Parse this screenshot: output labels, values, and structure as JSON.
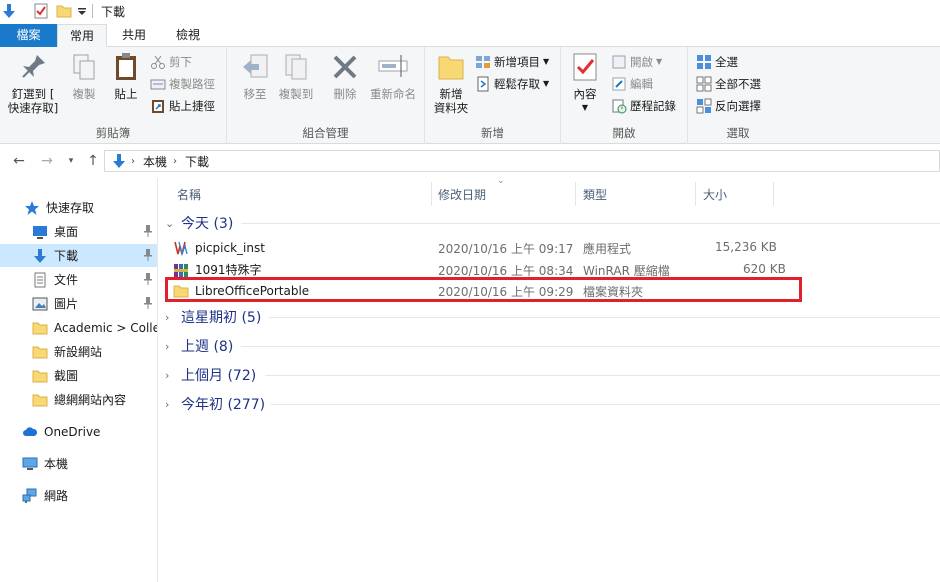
{
  "window": {
    "title": "下載"
  },
  "ribbon_tabs": [
    {
      "label": "檔案"
    },
    {
      "label": "常用"
    },
    {
      "label": "共用"
    },
    {
      "label": "檢視"
    }
  ],
  "ribbon": {
    "clipboard": {
      "pin_label_1": "釘選到 [",
      "pin_label_2": "快速存取]",
      "copy_label": "複製",
      "paste_label": "貼上",
      "cut_label": "剪下",
      "copy_path_label": "複製路徑",
      "paste_shortcut_label": "貼上捷徑",
      "group_label": "剪貼簿"
    },
    "organize": {
      "move_to_label": "移至",
      "copy_to_label": "複製到",
      "delete_label": "刪除",
      "rename_label": "重新命名",
      "group_label": "組合管理"
    },
    "new": {
      "new_folder_label_1": "新增",
      "new_folder_label_2": "資料夾",
      "new_item_label": "新增項目",
      "easy_access_label": "輕鬆存取",
      "group_label": "新增"
    },
    "open": {
      "properties_label": "內容",
      "open_label": "開啟",
      "edit_label": "編輯",
      "history_label": "歷程記錄",
      "group_label": "開啟"
    },
    "select": {
      "select_all_label": "全選",
      "select_none_label": "全部不選",
      "invert_label": "反向選擇",
      "group_label": "選取"
    }
  },
  "address": {
    "crumbs": [
      "本機",
      "下載"
    ]
  },
  "sidebar": {
    "quick_access": "快速存取",
    "items": [
      {
        "label": "桌面"
      },
      {
        "label": "下載"
      },
      {
        "label": "文件"
      },
      {
        "label": "圖片"
      },
      {
        "label": "Academic  >  Colle"
      },
      {
        "label": "新設網站"
      },
      {
        "label": "截圖"
      },
      {
        "label": "總網網站內容"
      }
    ],
    "onedrive": "OneDrive",
    "this_pc": "本機",
    "network": "網路"
  },
  "columns": {
    "name": "名稱",
    "date": "修改日期",
    "type": "類型",
    "size": "大小"
  },
  "groups": {
    "today": "今天 (3)",
    "this_week": "這星期初 (5)",
    "last_week": "上週 (8)",
    "last_month": "上個月 (72)",
    "this_year": "今年初 (277)"
  },
  "files": [
    {
      "name": "picpick_inst",
      "date": "2020/10/16 上午 09:17",
      "type": "應用程式",
      "size": "15,236 KB"
    },
    {
      "name": "1091特殊字",
      "date": "2020/10/16 上午 08:34",
      "type": "WinRAR 壓縮檔",
      "size": "620 KB"
    },
    {
      "name": "LibreOfficePortable",
      "date": "2020/10/16 上午 09:29",
      "type": "檔案資料夾",
      "size": ""
    }
  ],
  "colors": {
    "accent": "#1979ca",
    "selected": "#cce8ff",
    "highlight_box": "#e2202b",
    "group_header": "#1e3287"
  }
}
